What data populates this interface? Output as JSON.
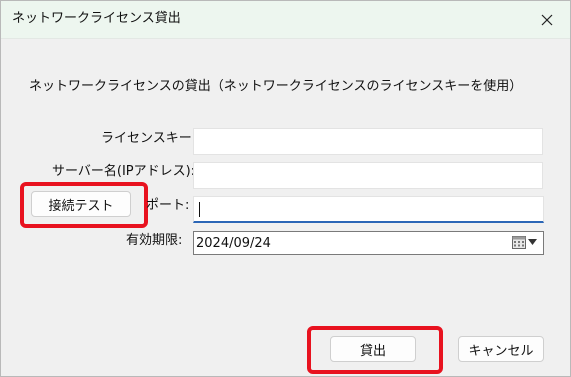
{
  "dialog": {
    "title": "ネットワークライセンス貸出"
  },
  "description": "ネットワークライセンスの貸出（ネットワークライセンスのライセンスキーを使用）",
  "form": {
    "license_key_label": "ライセンスキー:",
    "license_key_value": "",
    "server_name_label": "サーバー名(IPアドレス):",
    "server_name_value": "",
    "port_label": "ポート:",
    "port_value": "",
    "expiry_label": "有効期限:",
    "expiry_value": "2024/09/24"
  },
  "buttons": {
    "test_connection": "接続テスト",
    "lend": "貸出",
    "cancel": "キャンセル"
  },
  "colors": {
    "highlight": "#e8121f",
    "focus_underline": "#2b66b6",
    "titlebar": "#edf6ef"
  },
  "icons": {
    "close": "close-icon",
    "calendar": "calendar-icon",
    "dropdown": "chevron-down-icon"
  }
}
